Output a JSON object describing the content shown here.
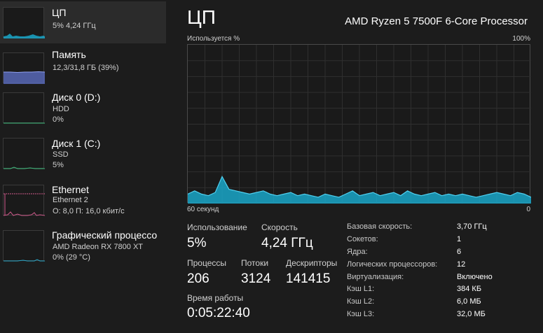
{
  "sidebar": {
    "items": [
      {
        "title": "ЦП",
        "sub1": "5%  4,24 ГГц",
        "sub2": "",
        "accent": "#1aa7c9",
        "icon": "cpu-graph-icon"
      },
      {
        "title": "Память",
        "sub1": "12,3/31,8 ГБ (39%)",
        "sub2": "",
        "accent": "#7a8fe0",
        "icon": "memory-graph-icon"
      },
      {
        "title": "Диск 0 (D:)",
        "sub1": "HDD",
        "sub2": "0%",
        "accent": "#3fbf7f",
        "icon": "disk-graph-icon"
      },
      {
        "title": "Диск 1 (C:)",
        "sub1": "SSD",
        "sub2": "5%",
        "accent": "#3fbf7f",
        "icon": "disk-graph-icon"
      },
      {
        "title": "Ethernet",
        "sub1": "Ethernet 2",
        "sub2": "О: 8,0 П: 16,0 кбит/с",
        "accent": "#d05a8c",
        "icon": "network-graph-icon"
      },
      {
        "title": "Графический процессо",
        "sub1": "AMD Radeon RX 7800 XT",
        "sub2": "0%  (29 °C)",
        "accent": "#2aa8c9",
        "icon": "gpu-graph-icon"
      }
    ]
  },
  "main": {
    "title": "ЦП",
    "cpu_name": "AMD Ryzen 5 7500F 6-Core Processor",
    "graph": {
      "top_left_label": "Используется %",
      "top_right_label": "100%",
      "bottom_left_label": "60 секунд",
      "bottom_right_label": "0",
      "fill_color": "#1aa7c9",
      "line_color": "#4fd0f0",
      "grid_color": "#2f2f2f",
      "usage_percent_history": [
        6,
        8,
        6,
        5,
        7,
        17,
        9,
        8,
        7,
        6,
        7,
        8,
        6,
        5,
        6,
        7,
        5,
        6,
        5,
        4,
        6,
        5,
        4,
        6,
        8,
        5,
        6,
        7,
        5,
        6,
        7,
        5,
        8,
        6,
        5,
        6,
        7,
        5,
        6,
        5,
        6,
        5,
        4,
        5,
        6,
        7,
        6,
        5,
        7,
        6,
        4
      ]
    },
    "stats": {
      "usage_label": "Использование",
      "usage_value": "5%",
      "speed_label": "Скорость",
      "speed_value": "4,24 ГГц",
      "processes_label": "Процессы",
      "processes_value": "206",
      "threads_label": "Потоки",
      "threads_value": "3124",
      "handles_label": "Дескрипторы",
      "handles_value": "141415",
      "uptime_label": "Время работы",
      "uptime_value": "0:05:22:40"
    },
    "details": [
      {
        "label": "Базовая скорость:",
        "value": "3,70 ГГц"
      },
      {
        "label": "Сокетов:",
        "value": "1"
      },
      {
        "label": "Ядра:",
        "value": "6"
      },
      {
        "label": "Логических процессоров:",
        "value": "12"
      },
      {
        "label": "Виртуализация:",
        "value": "Включено"
      },
      {
        "label": "Кэш L1:",
        "value": "384 КБ"
      },
      {
        "label": "Кэш L2:",
        "value": "6,0 МБ"
      },
      {
        "label": "Кэш L3:",
        "value": "32,0 МБ"
      }
    ]
  }
}
